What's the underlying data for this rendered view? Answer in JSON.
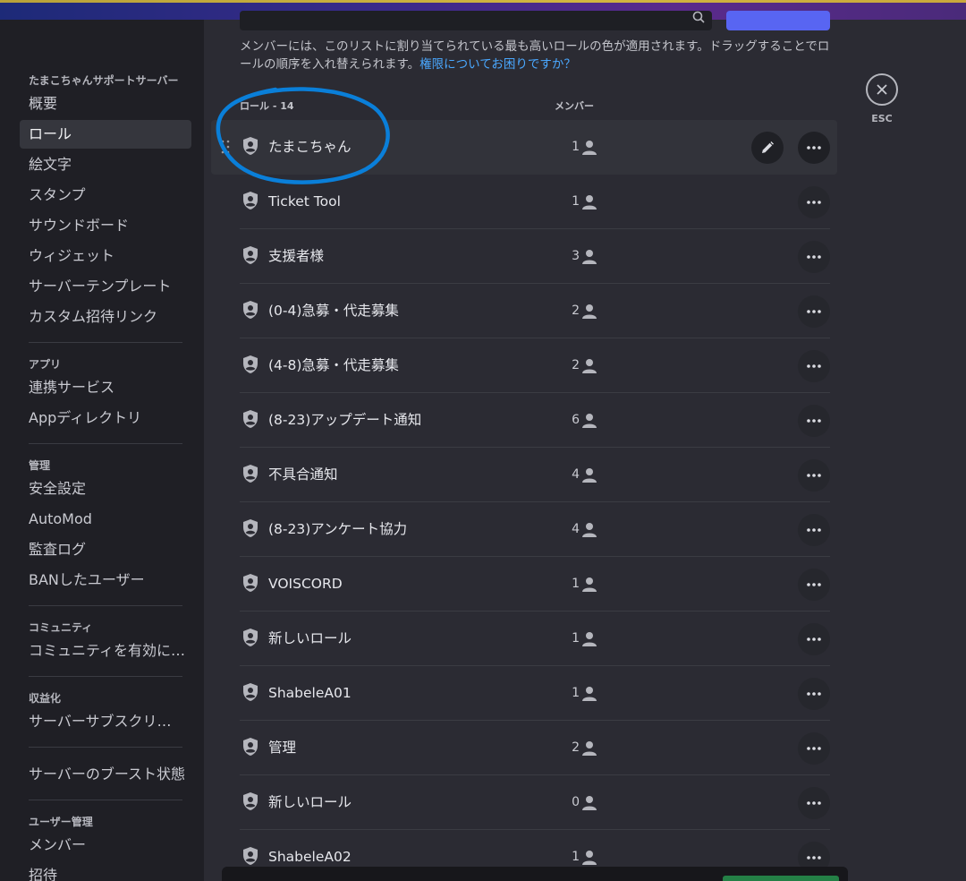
{
  "sidebar": {
    "server_name": "たまこちゃんサポートサーバー",
    "server_items": [
      "概要",
      "ロール",
      "絵文字",
      "スタンプ",
      "サウンドボード",
      "ウィジェット",
      "サーバーテンプレート",
      "カスタム招待リンク"
    ],
    "apps_title": "アプリ",
    "apps_items": [
      "連携サービス",
      "Appディレクトリ"
    ],
    "admin_title": "管理",
    "admin_items": [
      "安全設定",
      "AutoMod",
      "監査ログ",
      "BANしたユーザー"
    ],
    "community_title": "コミュニティ",
    "community_items": [
      "コミュニティを有効に…"
    ],
    "monetize_title": "収益化",
    "monetize_items": [
      "サーバーサブスクリ…"
    ],
    "boost_items": [
      "サーバーのブースト状態"
    ],
    "users_title": "ユーザー管理",
    "users_items": [
      "メンバー",
      "招待"
    ]
  },
  "description": {
    "text": "メンバーには、このリストに割り当てられている最も高いロールの色が適用されます。ドラッグすることでロールの順序を入れ替えられます。",
    "link": "権限についてお困りですか？"
  },
  "table": {
    "roles_header": "ロール - 14",
    "members_header": "メンバー",
    "rows": [
      {
        "name": "たまこちゃん",
        "count": "1"
      },
      {
        "name": "Ticket Tool",
        "count": "1"
      },
      {
        "name": "支援者様",
        "count": "3"
      },
      {
        "name": "(0-4)急募・代走募集",
        "count": "2"
      },
      {
        "name": "(4-8)急募・代走募集",
        "count": "2"
      },
      {
        "name": "(8-23)アップデート通知",
        "count": "6"
      },
      {
        "name": "不具合通知",
        "count": "4"
      },
      {
        "name": "(8-23)アンケート協力",
        "count": "4"
      },
      {
        "name": "VOISCORD",
        "count": "1"
      },
      {
        "name": "新しいロール",
        "count": "1"
      },
      {
        "name": "ShabeleA01",
        "count": "1"
      },
      {
        "name": "管理",
        "count": "2"
      },
      {
        "name": "新しいロール",
        "count": "0"
      },
      {
        "name": "ShabeleA02",
        "count": "1"
      }
    ]
  },
  "esc": {
    "label": "ESC"
  },
  "colors": {
    "accent": "#5865f2",
    "link": "#4aa8ff",
    "annotation": "#0a7fd9"
  }
}
